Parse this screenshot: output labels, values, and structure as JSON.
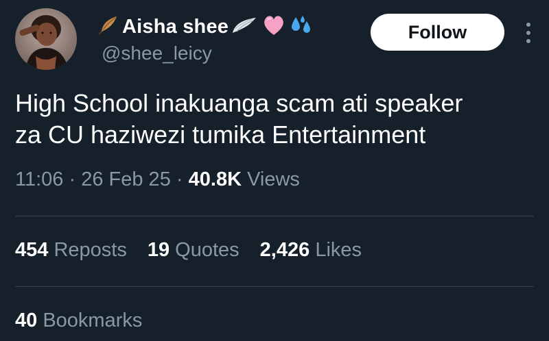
{
  "author": {
    "display_name": "Aisha shee",
    "handle": "@shee_leicy",
    "name_emojis": [
      "feather-icon",
      "wing-icon",
      "pink-heart-icon",
      "sweat-droplets-icon"
    ]
  },
  "follow_label": "Follow",
  "tweet": {
    "text_line1": "High School inakuanga scam ati speaker",
    "text_line2": "za CU haziwezi tumika Entertainment"
  },
  "meta": {
    "time": "11:06",
    "sep1": "·",
    "date": "26 Feb 25",
    "sep2": "·",
    "views_count": "40.8K",
    "views_label": "Views"
  },
  "stats": {
    "reposts_count": "454",
    "reposts_label": "Reposts",
    "quotes_count": "19",
    "quotes_label": "Quotes",
    "likes_count": "2,426",
    "likes_label": "Likes"
  },
  "bookmarks": {
    "count": "40",
    "label": "Bookmarks"
  },
  "colors": {
    "background": "#15202b",
    "secondary_text": "#8b98a5",
    "divider": "#38444d",
    "follow_bg": "#ffffff"
  }
}
